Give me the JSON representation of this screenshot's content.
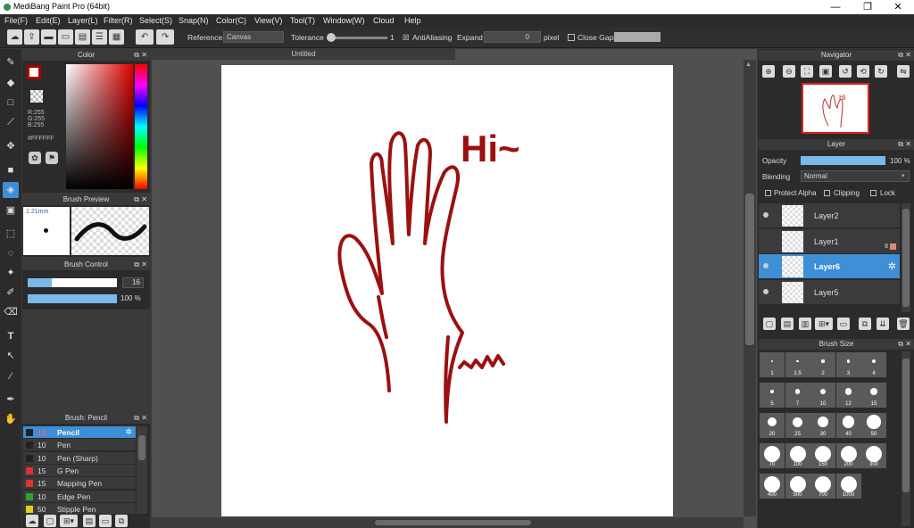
{
  "title": "MediBang Paint Pro (64bit)",
  "window_controls": {
    "minimize": "—",
    "maximize": "❐",
    "close": "✕"
  },
  "menu": [
    "File(F)",
    "Edit(E)",
    "Layer(L)",
    "Filter(R)",
    "Select(S)",
    "Snap(N)",
    "Color(C)",
    "View(V)",
    "Tool(T)",
    "Window(W)",
    "Cloud",
    "Help"
  ],
  "toolbar": {
    "reference_label": "Reference",
    "reference_value": "Canvas",
    "tolerance_label": "Tolerance",
    "tolerance_value": "1",
    "antialiasing_label": "AntiAliasing",
    "antialiasing_checked": "☒",
    "expand_label": "Expand",
    "expand_value": "0",
    "expand_unit": "pixel",
    "close_gaps_label": "Close Gaps"
  },
  "color_panel": {
    "title": "Color",
    "r": "R:255",
    "g": "G:255",
    "b": "B:255",
    "hex": "#FFFFFF",
    "primary_color": "#a00000"
  },
  "brush_preview": {
    "title": "Brush Preview",
    "size": "1.21mm"
  },
  "brush_control": {
    "title": "Brush Control",
    "size_value": "16",
    "size_fraction": 0.27,
    "opacity_value": "100 %",
    "opacity_fraction": 1.0
  },
  "brush_list": {
    "title": "Brush: Pencil",
    "items": [
      {
        "size": "16",
        "name": "Pencil",
        "color": "#222222"
      },
      {
        "size": "10",
        "name": "Pen",
        "color": "#222222"
      },
      {
        "size": "10",
        "name": "Pen (Sharp)",
        "color": "#222222"
      },
      {
        "size": "15",
        "name": "G Pen",
        "color": "#e03030"
      },
      {
        "size": "15",
        "name": "Mapping Pen",
        "color": "#e03030"
      },
      {
        "size": "10",
        "name": "Edge Pen",
        "color": "#2aa52a"
      },
      {
        "size": "50",
        "name": "Stipple Pen",
        "color": "#e0d020"
      }
    ]
  },
  "canvas": {
    "tab": "Untitled",
    "text_hi": "Hi~",
    "stroke_color": "#9b1010"
  },
  "navigator": {
    "title": "Navigator"
  },
  "layer_panel": {
    "title": "Layer",
    "opacity_label": "Opacity",
    "opacity_value": "100 %",
    "opacity_fraction": 1.0,
    "blending_label": "Blending",
    "blending_value": "Normal",
    "protect_alpha": "Protect Alpha",
    "clipping": "Clipping",
    "lock": "Lock",
    "layers": [
      {
        "name": "Layer2",
        "selected": false
      },
      {
        "name": "Layer1",
        "selected": false
      },
      {
        "name": "Layer6",
        "selected": true
      },
      {
        "name": "Layer5",
        "selected": false
      }
    ],
    "layer1_badge": "8"
  },
  "brush_size": {
    "title": "Brush Size",
    "sizes": [
      "1",
      "1.5",
      "2",
      "3",
      "4",
      "5",
      "7",
      "10",
      "12",
      "15",
      "20",
      "25",
      "30",
      "40",
      "50",
      "70",
      "100",
      "150",
      "200",
      "300",
      "400",
      "500",
      "700",
      "1000"
    ]
  }
}
